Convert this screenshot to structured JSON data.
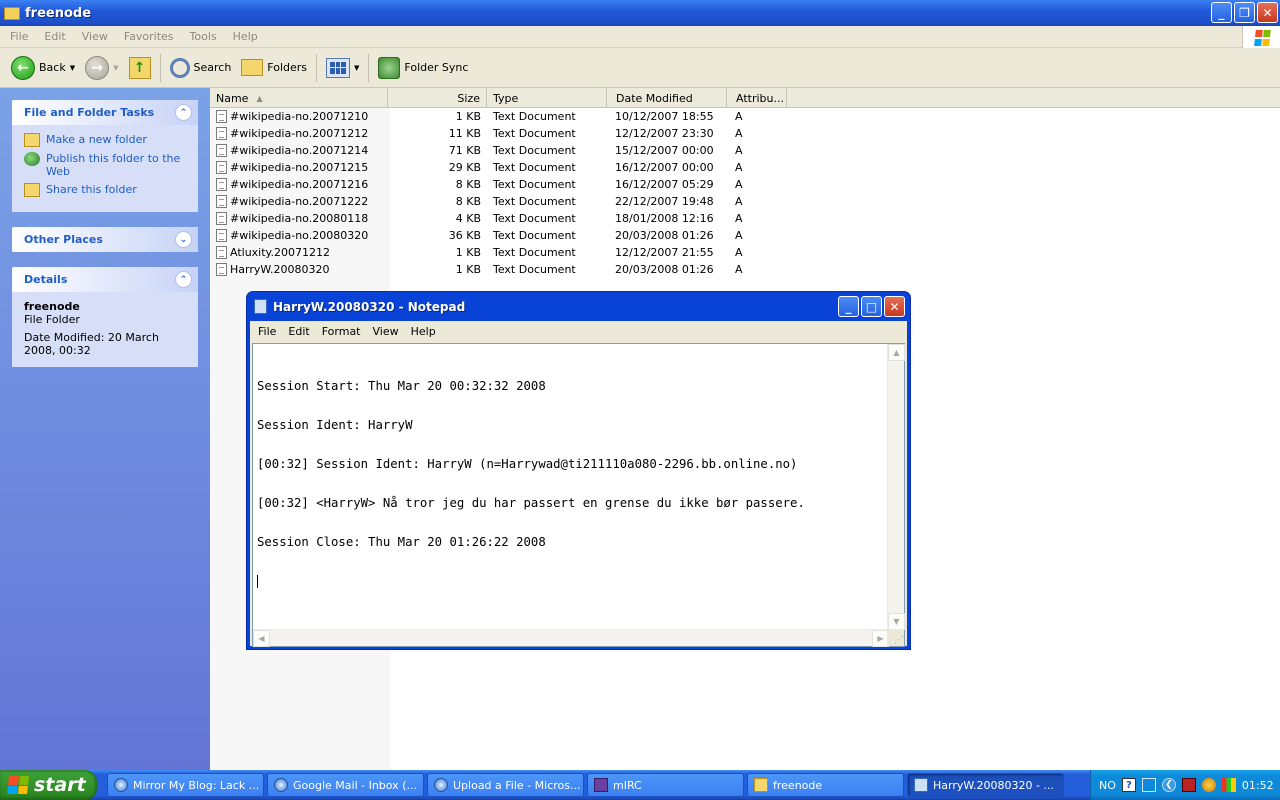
{
  "explorer": {
    "title": "freenode",
    "menu": [
      "File",
      "Edit",
      "View",
      "Favorites",
      "Tools",
      "Help"
    ],
    "toolbar": {
      "back_label": "Back",
      "search_label": "Search",
      "folders_label": "Folders",
      "folder_sync_label": "Folder Sync"
    }
  },
  "task_pane": {
    "file_tasks": {
      "title": "File and Folder Tasks",
      "items": [
        "Make a new folder",
        "Publish this folder to the Web",
        "Share this folder"
      ]
    },
    "other_places": {
      "title": "Other Places"
    },
    "details": {
      "title": "Details",
      "name": "freenode",
      "type": "File Folder",
      "modified": "Date Modified: 20 March 2008, 00:32"
    }
  },
  "file_list": {
    "columns": {
      "name": "Name",
      "size": "Size",
      "type": "Type",
      "date": "Date Modified",
      "attr": "Attribu..."
    },
    "rows": [
      {
        "name": "#wikipedia-no.20071210",
        "size": "1 KB",
        "type": "Text Document",
        "date": "10/12/2007 18:55",
        "attr": "A"
      },
      {
        "name": "#wikipedia-no.20071212",
        "size": "11 KB",
        "type": "Text Document",
        "date": "12/12/2007 23:30",
        "attr": "A"
      },
      {
        "name": "#wikipedia-no.20071214",
        "size": "71 KB",
        "type": "Text Document",
        "date": "15/12/2007 00:00",
        "attr": "A"
      },
      {
        "name": "#wikipedia-no.20071215",
        "size": "29 KB",
        "type": "Text Document",
        "date": "16/12/2007 00:00",
        "attr": "A"
      },
      {
        "name": "#wikipedia-no.20071216",
        "size": "8 KB",
        "type": "Text Document",
        "date": "16/12/2007 05:29",
        "attr": "A"
      },
      {
        "name": "#wikipedia-no.20071222",
        "size": "8 KB",
        "type": "Text Document",
        "date": "22/12/2007 19:48",
        "attr": "A"
      },
      {
        "name": "#wikipedia-no.20080118",
        "size": "4 KB",
        "type": "Text Document",
        "date": "18/01/2008 12:16",
        "attr": "A"
      },
      {
        "name": "#wikipedia-no.20080320",
        "size": "36 KB",
        "type": "Text Document",
        "date": "20/03/2008 01:26",
        "attr": "A"
      },
      {
        "name": "Atluxity.20071212",
        "size": "1 KB",
        "type": "Text Document",
        "date": "12/12/2007 21:55",
        "attr": "A"
      },
      {
        "name": "HarryW.20080320",
        "size": "1 KB",
        "type": "Text Document",
        "date": "20/03/2008 01:26",
        "attr": "A"
      }
    ]
  },
  "notepad": {
    "title": "HarryW.20080320 - Notepad",
    "menu": [
      "File",
      "Edit",
      "Format",
      "View",
      "Help"
    ],
    "lines": [
      "Session Start: Thu Mar 20 00:32:32 2008",
      "Session Ident: HarryW",
      "[00:32] Session Ident: HarryW (n=Harrywad@ti211110a080-2296.bb.online.no)",
      "[00:32] <HarryW> Nå tror jeg du har passert en grense du ikke bør passere.",
      "Session Close: Thu Mar 20 01:26:22 2008"
    ]
  },
  "taskbar": {
    "start_label": "start",
    "tasks": [
      {
        "label": "Mirror My Blog: Lack ...",
        "icon": "ie-icon"
      },
      {
        "label": "Google Mail - Inbox (...",
        "icon": "ie-icon"
      },
      {
        "label": "Upload a File - Micros...",
        "icon": "ie-icon"
      },
      {
        "label": "mIRC",
        "icon": "mirc-icon"
      },
      {
        "label": "freenode",
        "icon": "folder-icon"
      },
      {
        "label": "HarryW.20080320 - ...",
        "icon": "notepad-icon",
        "active": true
      }
    ],
    "tray": {
      "language": "NO",
      "clock": "01:52"
    }
  }
}
